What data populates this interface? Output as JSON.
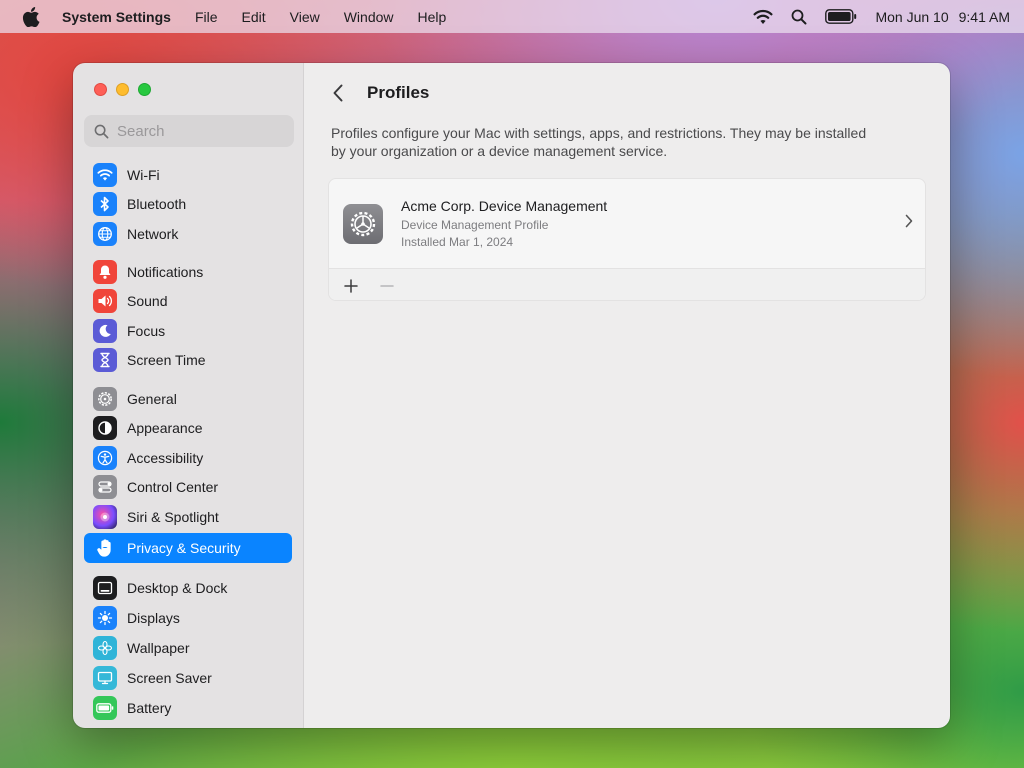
{
  "menubar": {
    "app_name": "System Settings",
    "menus": [
      "File",
      "Edit",
      "View",
      "Window",
      "Help"
    ],
    "date": "Mon Jun 10",
    "time": "9:41 AM"
  },
  "sidebar": {
    "search_placeholder": "Search",
    "items": [
      {
        "label": "Wi-Fi",
        "icon": "wifi-icon",
        "color": "#1a82fb"
      },
      {
        "label": "Bluetooth",
        "icon": "bluetooth-icon",
        "color": "#1a82fb"
      },
      {
        "label": "Network",
        "icon": "globe-icon",
        "color": "#1a82fb"
      },
      {
        "label": "Notifications",
        "icon": "bell-icon",
        "color": "#f0453a"
      },
      {
        "label": "Sound",
        "icon": "speaker-icon",
        "color": "#f0453a"
      },
      {
        "label": "Focus",
        "icon": "moon-icon",
        "color": "#5b5bd6"
      },
      {
        "label": "Screen Time",
        "icon": "hourglass-icon",
        "color": "#5b5bd6"
      },
      {
        "label": "General",
        "icon": "gear-icon",
        "color": "#8e8e93"
      },
      {
        "label": "Appearance",
        "icon": "appearance-icon",
        "color": "#1d1d1f"
      },
      {
        "label": "Accessibility",
        "icon": "accessibility-icon",
        "color": "#1a82fb"
      },
      {
        "label": "Control Center",
        "icon": "toggles-icon",
        "color": "#8e8e93"
      },
      {
        "label": "Siri & Spotlight",
        "icon": "siri-icon",
        "color": "#3a2a6e"
      },
      {
        "label": "Privacy & Security",
        "icon": "hand-icon",
        "color": "#1a82fb",
        "selected": true
      },
      {
        "label": "Desktop & Dock",
        "icon": "dock-icon",
        "color": "#1d1d1f"
      },
      {
        "label": "Displays",
        "icon": "sun-icon",
        "color": "#1a82fb"
      },
      {
        "label": "Wallpaper",
        "icon": "flower-icon",
        "color": "#2fb4d8"
      },
      {
        "label": "Screen Saver",
        "icon": "monitor-icon",
        "color": "#35b8d8"
      },
      {
        "label": "Battery",
        "icon": "battery-icon",
        "color": "#34c759"
      }
    ]
  },
  "content": {
    "title": "Profiles",
    "description": "Profiles configure your Mac with settings, apps, and restrictions. They may be installed by your organization or a device management service.",
    "profile": {
      "name": "Acme Corp. Device Management",
      "type": "Device Management Profile",
      "installed": "Installed Mar 1, 2024"
    }
  }
}
